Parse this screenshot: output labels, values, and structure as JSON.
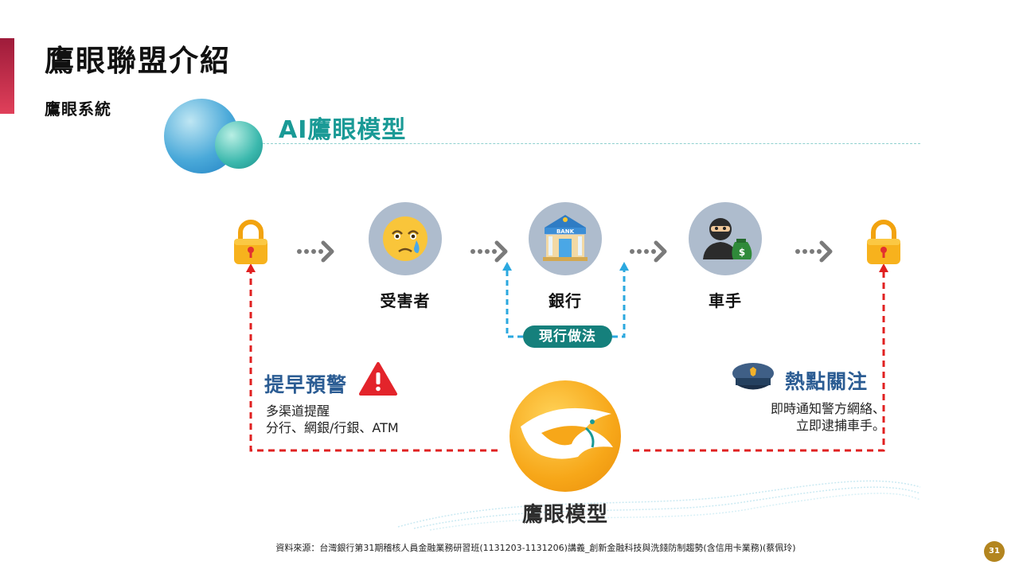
{
  "header": {
    "title": "鷹眼聯盟介紹",
    "subtitle": "鷹眼系統"
  },
  "model_section": {
    "title": "AI鷹眼模型"
  },
  "flow": {
    "nodes": [
      {
        "label": "受害者",
        "icon": "crying-face-icon"
      },
      {
        "label": "銀行",
        "icon": "bank-icon",
        "icon_text": "BANK"
      },
      {
        "label": "車手",
        "icon": "thief-with-money-bag-icon",
        "icon_text": "$"
      }
    ],
    "current_practice": "現行做法"
  },
  "early_warning": {
    "heading": "提早預警",
    "icon": "warning-triangle-icon",
    "lines": [
      "多渠道提醒",
      "分行、網銀/行銀、ATM"
    ]
  },
  "hotspot": {
    "heading": "熱點關注",
    "icon": "police-cap-icon",
    "lines": [
      "即時通知警方網絡、",
      "立即逮捕車手。"
    ]
  },
  "logo": {
    "label": "鷹眼模型",
    "icon": "eagle-logo-icon"
  },
  "footer": {
    "source": "資料來源：台灣銀行第31期稽核人員金融業務研習班(1131203-1131206)講義_創新金融科技與洗錢防制趨勢(含信用卡業務)(蔡佩玲)",
    "page_number": "31"
  },
  "colors": {
    "accent": "#c0284a",
    "teal": "#1a9a96",
    "navy": "#2b5c93",
    "red_dash": "#e02020",
    "blue_dash": "#2ba8df",
    "gold": "#f7a719"
  }
}
